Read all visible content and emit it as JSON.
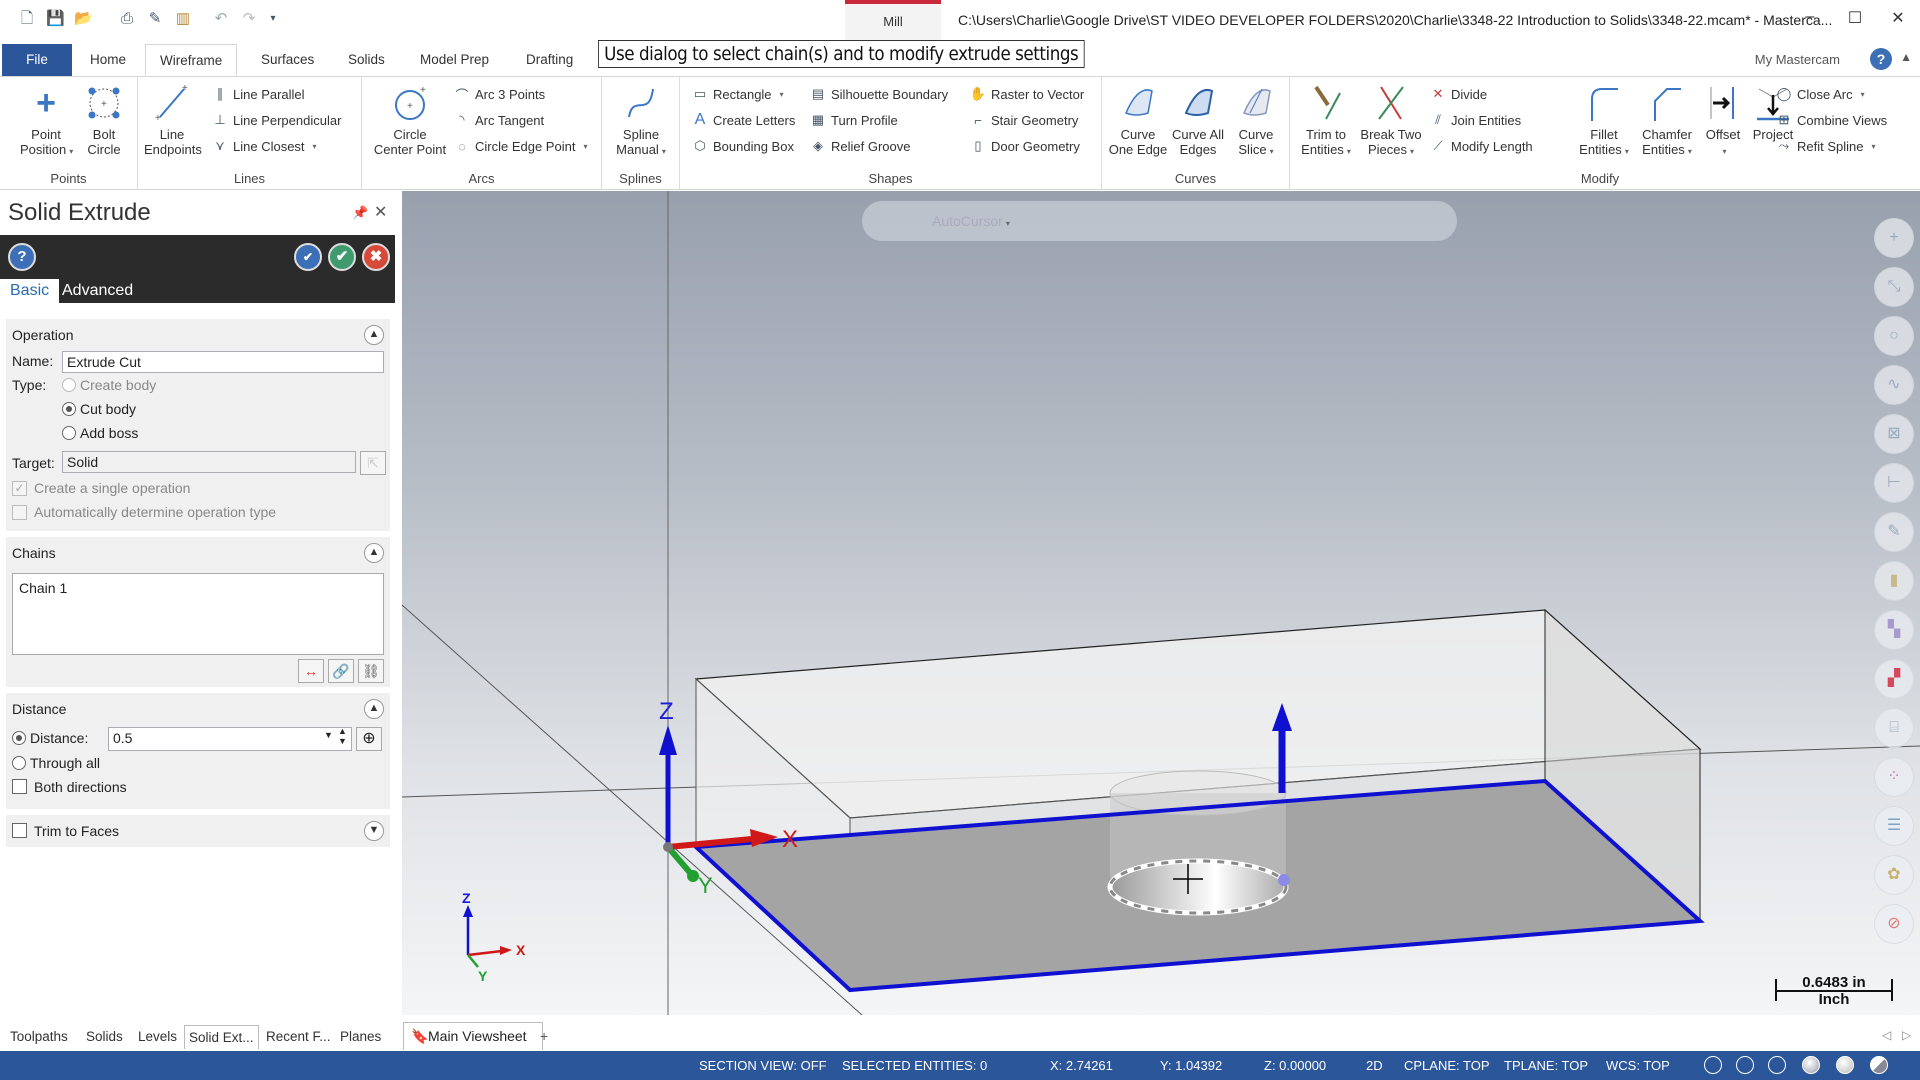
{
  "titlebar": {
    "context_tab": "Mill",
    "title": "C:\\Users\\Charlie\\Google Drive\\ST VIDEO DEVELOPER FOLDERS\\2020\\Charlie\\3348-22 Introduction to Solids\\3348-22.mcam* - Masterca...",
    "quick_access": [
      "new-icon",
      "save-icon",
      "open-icon",
      "print-icon",
      "save-as-icon",
      "zip2go-icon",
      "undo-icon",
      "redo-icon",
      "customize-icon"
    ],
    "minimize": "–",
    "maximize": "☐",
    "close": "✕"
  },
  "ribbon_tabs": [
    "File",
    "Home",
    "Wireframe",
    "Surfaces",
    "Solids",
    "Model Prep",
    "Drafting"
  ],
  "active_tab": "Wireframe",
  "prompt": "Use dialog to select chain(s) and to modify extrude settings",
  "my_mastercam": "My Mastercam",
  "ribbon": {
    "points": {
      "label": "Points",
      "buttons": [
        {
          "l1": "Point",
          "l2": "Position"
        },
        {
          "l1": "Bolt",
          "l2": "Circle"
        }
      ]
    },
    "lines": {
      "label": "Lines",
      "big": {
        "l1": "Line",
        "l2": "Endpoints"
      },
      "small": [
        "Line Parallel",
        "Line Perpendicular",
        "Line Closest"
      ]
    },
    "arcs": {
      "label": "Arcs",
      "big": {
        "l1": "Circle",
        "l2": "Center Point"
      },
      "small": [
        "Arc 3 Points",
        "Arc Tangent",
        "Circle Edge Point"
      ]
    },
    "splines": {
      "label": "Splines",
      "big": {
        "l1": "Spline",
        "l2": "Manual"
      }
    },
    "shapes": {
      "label": "Shapes",
      "col1": [
        "Rectangle",
        "Create Letters",
        "Bounding Box"
      ],
      "col2": [
        "Silhouette Boundary",
        "Turn Profile",
        "Relief Groove"
      ],
      "col3": [
        "Raster to Vector",
        "Stair Geometry",
        "Door Geometry"
      ]
    },
    "curves": {
      "label": "Curves",
      "buttons": [
        {
          "l1": "Curve",
          "l2": "One Edge"
        },
        {
          "l1": "Curve All",
          "l2": "Edges"
        },
        {
          "l1": "Curve",
          "l2": "Slice"
        }
      ]
    },
    "modify": {
      "label": "Modify",
      "big1": [
        {
          "l1": "Trim to",
          "l2": "Entities"
        },
        {
          "l1": "Break Two",
          "l2": "Pieces"
        }
      ],
      "small": [
        "Divide",
        "Join Entities",
        "Modify Length"
      ],
      "big2": [
        {
          "l1": "Fillet",
          "l2": "Entities"
        },
        {
          "l1": "Chamfer",
          "l2": "Entities"
        },
        {
          "l1": "Offset",
          "l2": ""
        },
        {
          "l1": "Project",
          "l2": ""
        }
      ],
      "small2": [
        "Close Arc",
        "Combine Views",
        "Refit Spline"
      ]
    }
  },
  "panel": {
    "title": "Solid Extrude",
    "tabs": [
      "Basic",
      "Advanced"
    ],
    "active_tab": "Basic",
    "operation": {
      "header": "Operation",
      "name_label": "Name:",
      "name_value": "Extrude Cut",
      "type_label": "Type:",
      "types": [
        {
          "label": "Create body",
          "selected": false,
          "disabled": true
        },
        {
          "label": "Cut body",
          "selected": true,
          "disabled": false
        },
        {
          "label": "Add boss",
          "selected": false,
          "disabled": false
        }
      ],
      "target_label": "Target:",
      "target_value": "Solid",
      "single_op_label": "Create a single operation",
      "single_op_checked": true,
      "auto_type_label": "Automatically determine operation type",
      "auto_type_checked": false
    },
    "chains": {
      "header": "Chains",
      "items": [
        "Chain  1"
      ]
    },
    "distance": {
      "header": "Distance",
      "distance_label": "Distance:",
      "distance_value": "0.5",
      "distance_selected": true,
      "through_all_label": "Through all",
      "both_dir_label": "Both directions",
      "both_dir_checked": false
    },
    "trim": {
      "label": "Trim to Faces",
      "checked": false
    }
  },
  "viewport": {
    "autocursor": "AutoCursor",
    "axis_labels": {
      "x": "X",
      "y": "Y",
      "z": "Z"
    },
    "scale_value": "0.6483 in",
    "scale_unit": "Inch"
  },
  "bottom_tabs": [
    "Toolpaths",
    "Solids",
    "Levels",
    "Solid Ext...",
    "Recent F...",
    "Planes"
  ],
  "active_bottom_tab": "Solid Ext...",
  "viewsheet": "Main Viewsheet",
  "add_viewsheet": "+",
  "status": {
    "section_view": "SECTION VIEW: OFF",
    "selected": "SELECTED ENTITIES: 0",
    "x": "X:  2.74261",
    "y": "Y:  1.04392",
    "z": "Z:  0.00000",
    "mode": "2D",
    "cplane": "CPLANE: TOP",
    "tplane": "TPLANE: TOP",
    "wcs": "WCS: TOP"
  },
  "colors": {
    "file_tab": "#2b579a",
    "status_bar": "#2b579a",
    "chain_highlight": "#1010d0",
    "mill_accent": "#c8283a"
  }
}
